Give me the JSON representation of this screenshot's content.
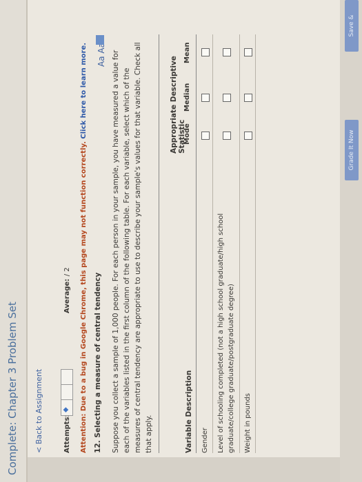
{
  "header": {
    "title": "Complete: Chapter 3 Problem Set"
  },
  "nav": {
    "back_label": "< Back to Assignment"
  },
  "status": {
    "attempts_label": "Attempts:",
    "average_label": "Average:",
    "average_value": "/ 2"
  },
  "notice": {
    "text": "Attention: Due to a bug in Google Chrome, this page may not function correctly. ",
    "link": "Click here to learn more."
  },
  "question": {
    "title": "12. Selecting a measure of central tendency",
    "font_size_label": "Aa Aa",
    "body": "Suppose you collect a sample of 1,000 people. For each person in your sample, you have measured a value for each of the variables listed in the first column of the following table. For each variable, select which of the measures of central tendency are appropriate to use to describe your sample's values for that variable. Check all that apply."
  },
  "table": {
    "group_header": "Appropriate Descriptive Statistic",
    "headers": [
      "Variable Description",
      "Mode",
      "Median",
      "Mean"
    ],
    "rows": [
      {
        "label": "Gender",
        "mode": false,
        "median": false,
        "mean": false
      },
      {
        "label": "Level of schooling completed (not a high school graduate/high school graduate/college graduate/postgraduate degree)",
        "mode": false,
        "median": false,
        "mean": false
      },
      {
        "label": "Weight in pounds",
        "mode": false,
        "median": false,
        "mean": false
      }
    ]
  },
  "buttons": {
    "grade": "Grade It Now",
    "save": "Save & Continue"
  },
  "colors": {
    "link": "#3f62a0",
    "attention": "#b4471e",
    "button": "#7f98c8"
  }
}
